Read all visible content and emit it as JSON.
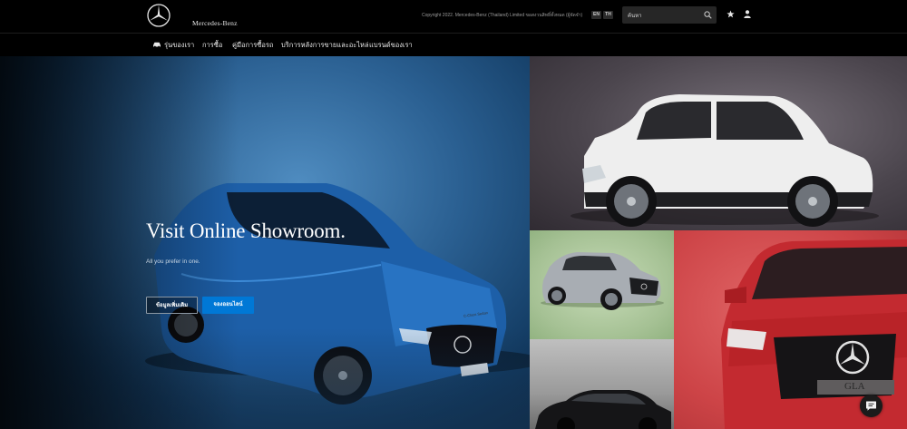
{
  "header": {
    "brand": "Mercedes-Benz",
    "copyright": "Copyright 2022. Mercedes-Benz (Thailand) Limited ขอสงวนสิทธิ์ทั้งหมด (ผู้จัดจำ)",
    "languages": [
      "EN",
      "TH"
    ],
    "search_placeholder": "ค้นหา",
    "icons": [
      "mercedes-star-logo",
      "search-icon",
      "star-icon",
      "user-icon"
    ]
  },
  "nav": {
    "items": [
      "รุ่นของเรา",
      "การซื้อ",
      "คู่มือการซื้อรถ",
      "บริการหลังการขายและอะไหล่",
      "แบรนด์ของเรา"
    ]
  },
  "hero": {
    "title": "Visit Online Showroom.",
    "subtitle": "All you prefer in one.",
    "buttons": [
      "ข้อมูลเพิ่มเติม",
      "จองออนไลน์"
    ],
    "plate": "C-Class Sedan"
  },
  "tiles": {
    "red_plate": "GLA"
  },
  "colors": {
    "accent": "#0078d6",
    "header_bg": "#000000",
    "hero_blue": "#2a5f91",
    "tile_green": "#a5c194",
    "tile_red": "#cd4447"
  },
  "chat": {
    "icon": "chat-bubble-icon"
  }
}
